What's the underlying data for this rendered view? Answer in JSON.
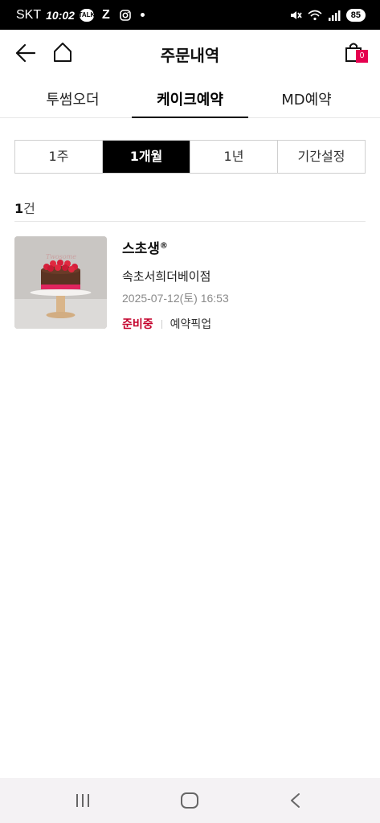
{
  "status_bar": {
    "carrier": "SKT",
    "time": "10:02",
    "battery": "85",
    "icons": [
      "kakaotalk-icon",
      "z-app-icon",
      "instagram-icon",
      "dot-icon",
      "mute-icon",
      "wifi-icon",
      "signal-icon",
      "battery-icon"
    ]
  },
  "header": {
    "title": "주문내역",
    "cart_count": "0"
  },
  "tabs": [
    {
      "label": "투썸오더",
      "active": false
    },
    {
      "label": "케이크예약",
      "active": true
    },
    {
      "label": "MD예약",
      "active": false
    }
  ],
  "period": [
    {
      "label": "1주",
      "active": false
    },
    {
      "label": "1개월",
      "active": true
    },
    {
      "label": "1년",
      "active": false
    },
    {
      "label": "기간설정",
      "active": false
    }
  ],
  "count": {
    "number": "1",
    "unit": "건"
  },
  "orders": [
    {
      "product_name": "스초생",
      "trademark": "®",
      "store": "속초서희더베이점",
      "datetime": "2025-07-12(토) 16:53",
      "status": "준비중",
      "order_type": "예약픽업"
    }
  ],
  "colors": {
    "accent": "#e5004f",
    "status_red": "#c4002b",
    "active_tab": "#000000"
  }
}
